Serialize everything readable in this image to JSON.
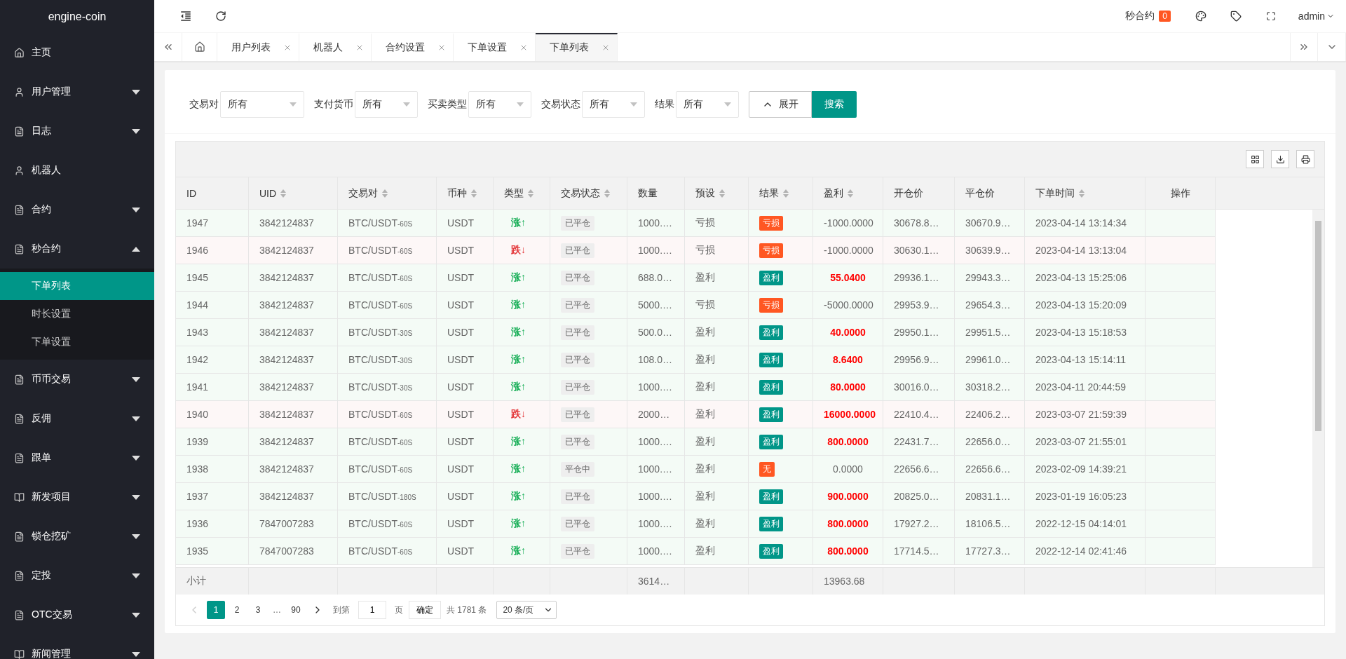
{
  "logo": "engine-coin",
  "sidebar": {
    "items": [
      {
        "label": "主页",
        "kind": "home",
        "expandable": false
      },
      {
        "label": "用户管理",
        "kind": "user",
        "expandable": true,
        "expanded": false
      },
      {
        "label": "日志",
        "kind": "doc",
        "expandable": true,
        "expanded": false
      },
      {
        "label": "机器人",
        "kind": "user",
        "expandable": false
      },
      {
        "label": "合约",
        "kind": "doc",
        "expandable": true,
        "expanded": false
      },
      {
        "label": "秒合约",
        "kind": "doc",
        "expandable": true,
        "expanded": true,
        "children": [
          {
            "label": "下单列表",
            "selected": true
          },
          {
            "label": "时长设置",
            "selected": false
          },
          {
            "label": "下单设置",
            "selected": false
          }
        ]
      },
      {
        "label": "币币交易",
        "kind": "doc",
        "expandable": true,
        "expanded": false
      },
      {
        "label": "反佣",
        "kind": "doc",
        "expandable": true,
        "expanded": false
      },
      {
        "label": "跟单",
        "kind": "doc",
        "expandable": true,
        "expanded": false
      },
      {
        "label": "新发项目",
        "kind": "book",
        "expandable": true,
        "expanded": false
      },
      {
        "label": "锁仓挖矿",
        "kind": "doc",
        "expandable": true,
        "expanded": false
      },
      {
        "label": "定投",
        "kind": "doc",
        "expandable": true,
        "expanded": false
      },
      {
        "label": "OTC交易",
        "kind": "doc",
        "expandable": true,
        "expanded": false
      },
      {
        "label": "新闻管理",
        "kind": "book",
        "expandable": true,
        "expanded": false
      }
    ]
  },
  "header": {
    "notice_label": "秒合约",
    "notice_count": "0",
    "user": "admin"
  },
  "tabs": [
    {
      "label": "用户列表",
      "selected": false
    },
    {
      "label": "机器人",
      "selected": false
    },
    {
      "label": "合约设置",
      "selected": false
    },
    {
      "label": "下单设置",
      "selected": false
    },
    {
      "label": "下单列表",
      "selected": true
    }
  ],
  "filters": [
    {
      "label": "交易对",
      "value": "所有"
    },
    {
      "label": "支付货币",
      "value": "所有"
    },
    {
      "label": "买卖类型",
      "value": "所有"
    },
    {
      "label": "交易状态",
      "value": "所有"
    },
    {
      "label": "结果",
      "value": "所有"
    }
  ],
  "expand_button": "展开",
  "search_button": "搜索",
  "table": {
    "columns": [
      {
        "label": "ID",
        "sortable": false
      },
      {
        "label": "UID",
        "sortable": true
      },
      {
        "label": "交易对",
        "sortable": true
      },
      {
        "label": "币种",
        "sortable": true
      },
      {
        "label": "类型",
        "sortable": true
      },
      {
        "label": "交易状态",
        "sortable": true
      },
      {
        "label": "数量",
        "sortable": false
      },
      {
        "label": "预设",
        "sortable": true
      },
      {
        "label": "结果",
        "sortable": true
      },
      {
        "label": "盈利",
        "sortable": true
      },
      {
        "label": "开仓价",
        "sortable": false
      },
      {
        "label": "平仓价",
        "sortable": false
      },
      {
        "label": "下单时间",
        "sortable": true
      },
      {
        "label": "操作",
        "sortable": false
      }
    ],
    "rows": [
      {
        "id": "1947",
        "uid": "3842124837",
        "pair": "BTC/USDT",
        "period": "-60S",
        "coin": "USDT",
        "falling": false,
        "type": "涨↑",
        "status": "已平仓",
        "qty": "1000.…",
        "preset": "亏损",
        "result": {
          "kind": "loss",
          "label": "亏损"
        },
        "profit": "-1000.0000",
        "emphasis": false,
        "open": "30678.8…",
        "close": "30670.9…",
        "time": "2023-04-14 13:14:34"
      },
      {
        "id": "1946",
        "uid": "3842124837",
        "pair": "BTC/USDT",
        "period": "-60S",
        "coin": "USDT",
        "falling": true,
        "type": "跌↓",
        "status": "已平仓",
        "qty": "1000.…",
        "preset": "亏损",
        "result": {
          "kind": "loss",
          "label": "亏损"
        },
        "profit": "-1000.0000",
        "emphasis": false,
        "open": "30630.1…",
        "close": "30639.9…",
        "time": "2023-04-14 13:13:04"
      },
      {
        "id": "1945",
        "uid": "3842124837",
        "pair": "BTC/USDT",
        "period": "-60S",
        "coin": "USDT",
        "falling": false,
        "type": "涨↑",
        "status": "已平仓",
        "qty": "688.0…",
        "preset": "盈利",
        "result": {
          "kind": "profit",
          "label": "盈利"
        },
        "profit": "55.0400",
        "emphasis": true,
        "open": "29936.1…",
        "close": "29943.3…",
        "time": "2023-04-13 15:25:06"
      },
      {
        "id": "1944",
        "uid": "3842124837",
        "pair": "BTC/USDT",
        "period": "-60S",
        "coin": "USDT",
        "falling": false,
        "type": "涨↑",
        "status": "已平仓",
        "qty": "5000.…",
        "preset": "亏损",
        "result": {
          "kind": "loss",
          "label": "亏损"
        },
        "profit": "-5000.0000",
        "emphasis": false,
        "open": "29953.9…",
        "close": "29654.3…",
        "time": "2023-04-13 15:20:09"
      },
      {
        "id": "1943",
        "uid": "3842124837",
        "pair": "BTC/USDT",
        "period": "-30S",
        "coin": "USDT",
        "falling": false,
        "type": "涨↑",
        "status": "已平仓",
        "qty": "500.0…",
        "preset": "盈利",
        "result": {
          "kind": "profit",
          "label": "盈利"
        },
        "profit": "40.0000",
        "emphasis": true,
        "open": "29950.1…",
        "close": "29951.5…",
        "time": "2023-04-13 15:18:53"
      },
      {
        "id": "1942",
        "uid": "3842124837",
        "pair": "BTC/USDT",
        "period": "-30S",
        "coin": "USDT",
        "falling": false,
        "type": "涨↑",
        "status": "已平仓",
        "qty": "108.0…",
        "preset": "盈利",
        "result": {
          "kind": "profit",
          "label": "盈利"
        },
        "profit": "8.6400",
        "emphasis": true,
        "open": "29956.9…",
        "close": "29961.0…",
        "time": "2023-04-13 15:14:11"
      },
      {
        "id": "1941",
        "uid": "3842124837",
        "pair": "BTC/USDT",
        "period": "-30S",
        "coin": "USDT",
        "falling": false,
        "type": "涨↑",
        "status": "已平仓",
        "qty": "1000.…",
        "preset": "盈利",
        "result": {
          "kind": "profit",
          "label": "盈利"
        },
        "profit": "80.0000",
        "emphasis": true,
        "open": "30016.0…",
        "close": "30318.2…",
        "time": "2023-04-11 20:44:59"
      },
      {
        "id": "1940",
        "uid": "3842124837",
        "pair": "BTC/USDT",
        "period": "-60S",
        "coin": "USDT",
        "falling": true,
        "type": "跌↓",
        "status": "已平仓",
        "qty": "2000…",
        "preset": "盈利",
        "result": {
          "kind": "profit",
          "label": "盈利"
        },
        "profit": "16000.0000",
        "emphasis": true,
        "open": "22410.4…",
        "close": "22406.2…",
        "time": "2023-03-07 21:59:39"
      },
      {
        "id": "1939",
        "uid": "3842124837",
        "pair": "BTC/USDT",
        "period": "-60S",
        "coin": "USDT",
        "falling": false,
        "type": "涨↑",
        "status": "已平仓",
        "qty": "1000.…",
        "preset": "盈利",
        "result": {
          "kind": "profit",
          "label": "盈利"
        },
        "profit": "800.0000",
        "emphasis": true,
        "open": "22431.7…",
        "close": "22656.0…",
        "time": "2023-03-07 21:55:01"
      },
      {
        "id": "1938",
        "uid": "3842124837",
        "pair": "BTC/USDT",
        "period": "-60S",
        "coin": "USDT",
        "falling": false,
        "type": "涨↑",
        "status": "平仓中",
        "qty": "1000.…",
        "preset": "盈利",
        "result": {
          "kind": "none",
          "label": "无"
        },
        "profit": "0.0000",
        "emphasis": false,
        "open": "22656.6…",
        "close": "22656.6…",
        "time": "2023-02-09 14:39:21"
      },
      {
        "id": "1937",
        "uid": "3842124837",
        "pair": "BTC/USDT",
        "period": "-180S",
        "coin": "USDT",
        "falling": false,
        "type": "涨↑",
        "status": "已平仓",
        "qty": "1000.…",
        "preset": "盈利",
        "result": {
          "kind": "profit",
          "label": "盈利"
        },
        "profit": "900.0000",
        "emphasis": true,
        "open": "20825.0…",
        "close": "20831.1…",
        "time": "2023-01-19 16:05:23"
      },
      {
        "id": "1936",
        "uid": "7847007283",
        "pair": "BTC/USDT",
        "period": "-60S",
        "coin": "USDT",
        "falling": false,
        "type": "涨↑",
        "status": "已平仓",
        "qty": "1000.…",
        "preset": "盈利",
        "result": {
          "kind": "profit",
          "label": "盈利"
        },
        "profit": "800.0000",
        "emphasis": true,
        "open": "17927.2…",
        "close": "18106.5…",
        "time": "2022-12-15 04:14:01"
      },
      {
        "id": "1935",
        "uid": "7847007283",
        "pair": "BTC/USDT",
        "period": "-60S",
        "coin": "USDT",
        "falling": false,
        "type": "涨↑",
        "status": "已平仓",
        "qty": "1000.…",
        "preset": "盈利",
        "result": {
          "kind": "profit",
          "label": "盈利"
        },
        "profit": "800.0000",
        "emphasis": true,
        "open": "17714.5…",
        "close": "17727.3…",
        "time": "2022-12-14 02:41:46"
      }
    ],
    "subtotal": {
      "label": "小计",
      "qty": "3614…",
      "profit": "13963.68"
    }
  },
  "pagination": {
    "pages": [
      {
        "label": "1",
        "selected": true
      },
      {
        "label": "2",
        "selected": false
      },
      {
        "label": "3",
        "selected": false
      }
    ],
    "ellipsis": "…",
    "last": "90",
    "goto_label": "到第",
    "goto_value": "1",
    "page_unit": "页",
    "confirm": "确定",
    "total": "共 1781 条",
    "page_size": "20 条/页"
  }
}
